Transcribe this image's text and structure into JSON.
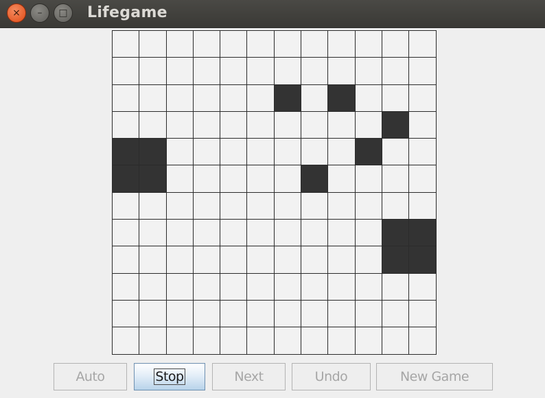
{
  "window": {
    "title": "Lifegame",
    "controls": {
      "close": "×",
      "minimize": "–",
      "maximize": "□"
    }
  },
  "board": {
    "rows": 12,
    "cols": 12,
    "alive_cells": [
      [
        2,
        6
      ],
      [
        2,
        8
      ],
      [
        3,
        10
      ],
      [
        4,
        0
      ],
      [
        4,
        1
      ],
      [
        4,
        9
      ],
      [
        5,
        0
      ],
      [
        5,
        1
      ],
      [
        5,
        7
      ],
      [
        7,
        10
      ],
      [
        7,
        11
      ],
      [
        8,
        10
      ],
      [
        8,
        11
      ]
    ]
  },
  "buttons": [
    {
      "id": "auto",
      "label": "Auto",
      "enabled": false,
      "focused": false
    },
    {
      "id": "stop",
      "label": "Stop",
      "enabled": true,
      "focused": true
    },
    {
      "id": "next",
      "label": "Next",
      "enabled": false,
      "focused": false
    },
    {
      "id": "undo",
      "label": "Undo",
      "enabled": false,
      "focused": false
    },
    {
      "id": "new-game",
      "label": "New Game",
      "enabled": false,
      "focused": false
    }
  ],
  "colors": {
    "alive": "#333333",
    "dead": "#f2f2f2",
    "grid": "#2b2b2b",
    "titlebar": "#3c3b37",
    "close": "#e95420"
  }
}
